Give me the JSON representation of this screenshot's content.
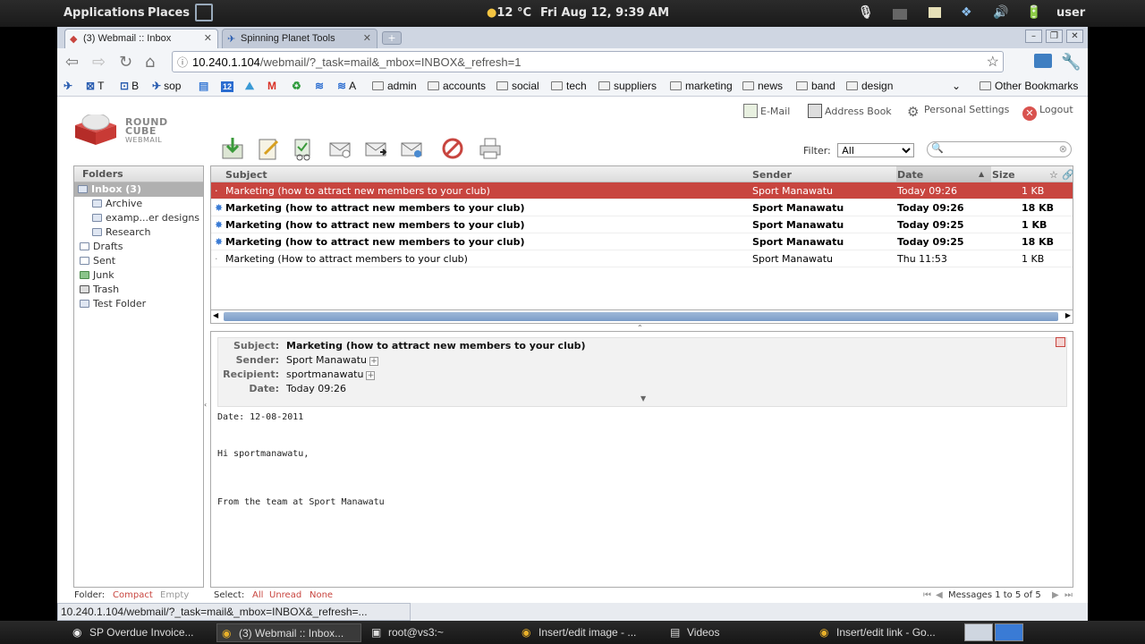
{
  "panel": {
    "applications": "Applications",
    "places": "Places",
    "weather": "12 °C",
    "clock": "Fri Aug 12,  9:39 AM",
    "user": "user"
  },
  "browser": {
    "tabs": [
      {
        "label": "(3) Webmail :: Inbox",
        "icon": "roundcube-icon"
      },
      {
        "label": "Spinning Planet Tools",
        "icon": "spinning-planet-icon"
      }
    ],
    "url_host": "10.240.1.104",
    "url_path": "/webmail/?_task=mail&_mbox=INBOX&_refresh=1",
    "bookmarks": [
      "T",
      "B",
      "sop",
      "12",
      "A",
      "admin",
      "accounts",
      "social",
      "tech",
      "suppliers",
      "marketing",
      "news",
      "band",
      "design"
    ],
    "other_bookmarks": "Other Bookmarks",
    "status_url": "10.240.1.104/webmail/?_task=mail&_mbox=INBOX&_refresh=..."
  },
  "app": {
    "logo_line1": "ROUND",
    "logo_line2": "CUBE",
    "logo_line3": "WEBMAIL",
    "nav": {
      "email": "E-Mail",
      "address_book": "Address Book",
      "settings": "Personal Settings",
      "logout": "Logout"
    },
    "filter_label": "Filter:",
    "filter_value": "All",
    "folders_header": "Folders",
    "folders": [
      {
        "label": "Inbox (3)",
        "selected": true
      },
      {
        "label": "Archive"
      },
      {
        "label": "examp...er designs"
      },
      {
        "label": "Research"
      },
      {
        "label": "Drafts"
      },
      {
        "label": "Sent"
      },
      {
        "label": "Junk"
      },
      {
        "label": "Trash"
      },
      {
        "label": "Test Folder"
      }
    ],
    "columns": {
      "subject": "Subject",
      "sender": "Sender",
      "date": "Date",
      "size": "Size"
    },
    "messages": [
      {
        "subject": "Marketing (how to attract new members to your club)",
        "sender": "Sport Manawatu",
        "date": "Today 09:26",
        "size": "1 KB",
        "selected": true,
        "unread": false
      },
      {
        "subject": "Marketing (how to attract new members to your club)",
        "sender": "Sport Manawatu",
        "date": "Today 09:26",
        "size": "18 KB",
        "selected": false,
        "unread": true
      },
      {
        "subject": "Marketing (how to attract new members to your club)",
        "sender": "Sport Manawatu",
        "date": "Today 09:25",
        "size": "1 KB",
        "selected": false,
        "unread": true
      },
      {
        "subject": "Marketing (how to attract new members to your club)",
        "sender": "Sport Manawatu",
        "date": "Today 09:25",
        "size": "18 KB",
        "selected": false,
        "unread": true
      },
      {
        "subject": "Marketing (How to attract members to your club)",
        "sender": "Sport Manawatu",
        "date": "Thu 11:53",
        "size": "1 KB",
        "selected": false,
        "unread": false
      }
    ],
    "preview": {
      "subject_label": "Subject:",
      "subject": "Marketing (how to attract new members to your club)",
      "sender_label": "Sender:",
      "sender": "Sport Manawatu",
      "recipient_label": "Recipient:",
      "recipient": "sportmanawatu",
      "date_label": "Date:",
      "date": "Today 09:26",
      "body": [
        "Date: 12-08-2011",
        "Hi sportmanawatu,",
        "From the team at Sport Manawatu"
      ]
    },
    "footer": {
      "folder_label": "Folder:",
      "compact": "Compact",
      "empty": "Empty",
      "select_label": "Select:",
      "all": "All",
      "unread": "Unread",
      "none": "None",
      "count": "Messages 1 to 5 of 5"
    }
  },
  "taskbar": [
    {
      "label": "SP Overdue Invoice...",
      "active": false
    },
    {
      "label": "(3) Webmail :: Inbox...",
      "active": true
    },
    {
      "label": "root@vs3:~",
      "active": false
    },
    {
      "label": "Insert/edit image - ...",
      "active": false
    },
    {
      "label": "Videos",
      "active": false
    },
    {
      "label": "Insert/edit link - Go...",
      "active": false
    }
  ],
  "colors": {
    "accent": "#c8453f",
    "scrollbar": "#7b9cc8"
  }
}
